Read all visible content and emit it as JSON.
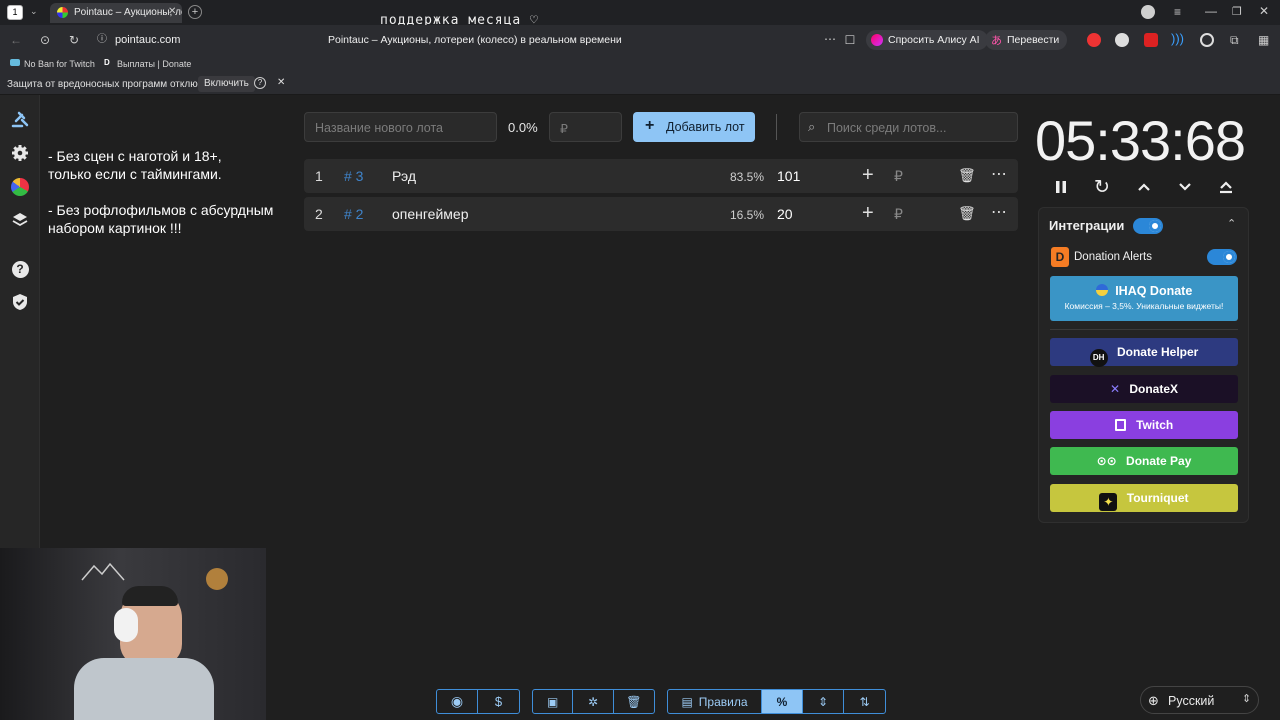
{
  "browser": {
    "tab_count": "1",
    "active_tab_title": "Pointauc – Аукционы, лотереи (колесо)",
    "address": "pointauc.com",
    "page_title": "Pointauc – Аукционы, лотереи (колесо) в реальном времени",
    "overlay_text": "поддержка месяца ♡",
    "ask_alice": "Спросить Алису AI",
    "translate": "Перевести",
    "bookmarks": [
      "No Ban for Twitch",
      "Выплаты | Donate"
    ],
    "infobar_text": "Защита от вредоносных программ отключена",
    "infobar_button": "Включить"
  },
  "rules_text": "- Без сцен с наготой и 18+,\nтолько если с таймингами.\n\n- Без рофлофильмов с абсурдным набором картинок !!!",
  "lot_form": {
    "name_placeholder": "Название нового лота",
    "percent": "0.0%",
    "amount_placeholder": "₽",
    "add_button": "Добавить лот",
    "search_placeholder": "Поиск среди лотов..."
  },
  "lots": [
    {
      "index": "1",
      "id": "# 3",
      "name": "Рэд",
      "percent": "83.5%",
      "amount": "101"
    },
    {
      "index": "2",
      "id": "# 2",
      "name": "опенгеймер",
      "percent": "16.5%",
      "amount": "20"
    }
  ],
  "timer": "05:33:68",
  "integrations": {
    "title": "Интеграции",
    "donation_alerts": "Donation Alerts",
    "ihaq": "IHAQ Donate",
    "ihaq_sub": "Комиссия – 3,5%. Уникальные виджеты!",
    "buttons": [
      "Donate Helper",
      "DonateX",
      "Twitch",
      "Donate Pay",
      "Tourniquet"
    ]
  },
  "bottom_bar": {
    "rules_button": "Правила",
    "percent_button": "%"
  },
  "language": "Русский",
  "colors": {
    "accent": "#8ec5f5",
    "donatex": "#1b1026",
    "twitch": "#8a3fe0",
    "donatepay": "#3fb950",
    "tourniquet": "#c6c63e",
    "helper": "#2d3a80",
    "ihaq": "#3a95c6"
  }
}
